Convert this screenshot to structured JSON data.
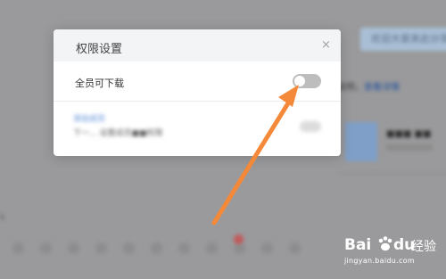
{
  "background": {
    "banner_text": "欢迎大家来此分享",
    "desc_text": "说明，",
    "desc_link": "查看详情",
    "card_text": "■■■ ■■"
  },
  "dialog": {
    "title": "权限设置",
    "close_label": "×",
    "options": [
      {
        "label": "全员可下载",
        "enabled": false
      }
    ],
    "blurred_link": "添加成员",
    "blurred_text": "下一... 设置成员■■权限"
  },
  "watermark": {
    "brand_prefix": "Bai",
    "brand_suffix": "du",
    "product": "经验",
    "url": "jingyan.baidu.com"
  },
  "colors": {
    "arrow": "#f5893a",
    "toggle_off": "#bdbdbd",
    "overlay": "#9a9a9c"
  }
}
